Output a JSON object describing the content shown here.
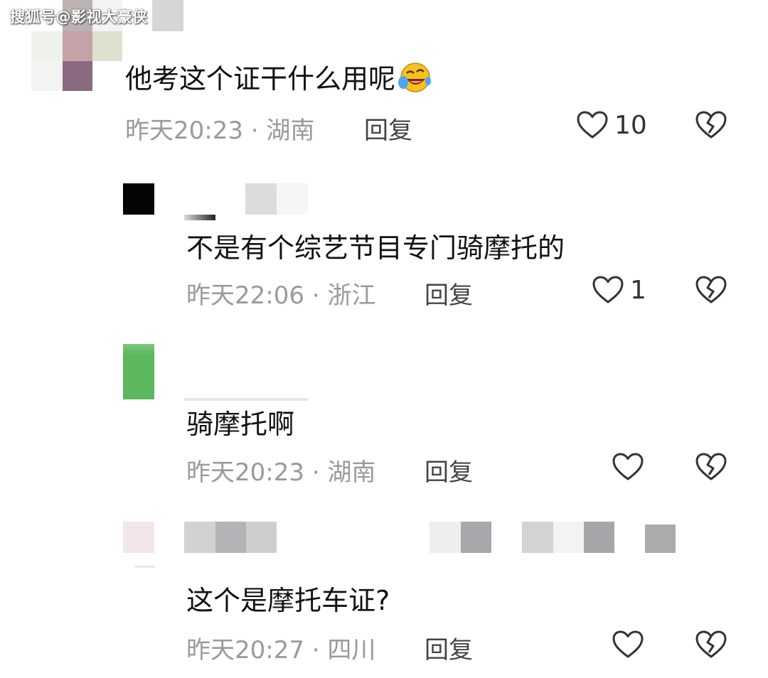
{
  "watermark": "搜狐号@影视大豪侠",
  "comments": [
    {
      "text": "他考这个证干什么用呢",
      "emoji": "laughing-crying-emoji",
      "time": "昨天20:23",
      "sep": "·",
      "location": "湖南",
      "reply_label": "回复",
      "likes": "10"
    },
    {
      "text": "不是有个综艺节目专门骑摩托的",
      "time": "昨天22:06",
      "sep": "·",
      "location": "浙江",
      "reply_label": "回复",
      "likes": "1"
    },
    {
      "text": "骑摩托啊",
      "time": "昨天20:23",
      "sep": "·",
      "location": "湖南",
      "reply_label": "回复",
      "likes": ""
    },
    {
      "text": "这个是摩托车证?",
      "time": "昨天20:27",
      "sep": "·",
      "location": "四川",
      "reply_label": "回复",
      "likes": ""
    }
  ],
  "icons": {
    "like": "heart-outline-icon",
    "dislike": "broken-heart-icon"
  },
  "colors": {
    "meta_gray": "#9a9a9a",
    "icon_stroke": "#333333",
    "avatar_green": "#5cb85c"
  }
}
